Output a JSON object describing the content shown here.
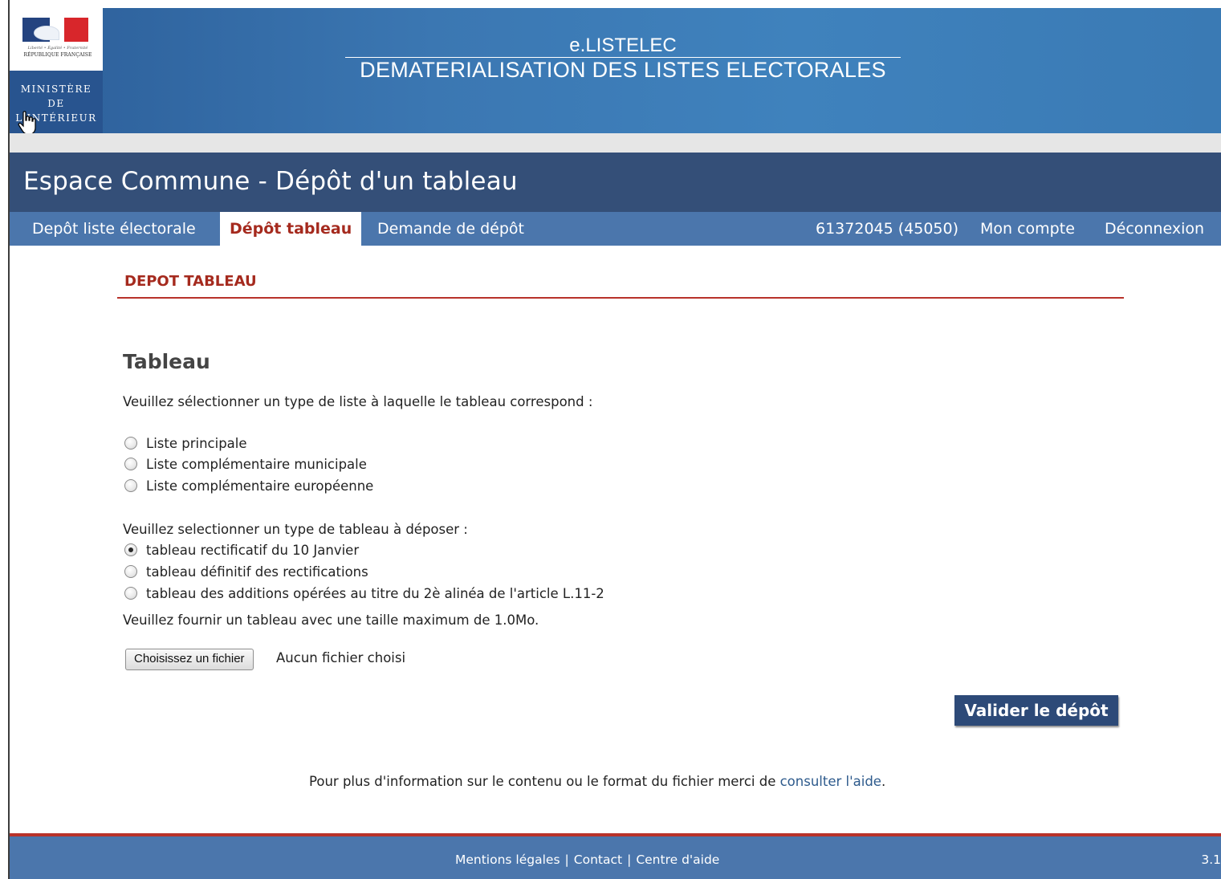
{
  "banner": {
    "logo": {
      "motto": "Liberté • Égalité • Fraternité",
      "republic": "RÉPUBLIQUE FRANÇAISE",
      "ministry_line1": "MINISTÈRE",
      "ministry_line2": "DE",
      "ministry_line3": "L'INTÉRIEUR"
    },
    "app_name": "e.LISTELEC",
    "app_subtitle": "DEMATERIALISATION DES LISTES ELECTORALES"
  },
  "header": {
    "title": "Espace Commune - Dépôt d'un tableau"
  },
  "nav": {
    "items": [
      {
        "label": "Depôt liste électorale",
        "active": false
      },
      {
        "label": "Dépôt tableau",
        "active": true
      },
      {
        "label": "Demande de dépôt",
        "active": false
      }
    ],
    "account_id": "61372045 (45050)",
    "my_account": "Mon compte",
    "logout": "Déconnexion"
  },
  "main": {
    "section_title": "DEPOT TABLEAU",
    "heading": "Tableau",
    "list_prompt": "Veuillez sélectionner un type de liste à laquelle le tableau correspond :",
    "list_options": [
      {
        "label": "Liste principale",
        "checked": false
      },
      {
        "label": "Liste complémentaire municipale",
        "checked": false
      },
      {
        "label": "Liste complémentaire européenne",
        "checked": false
      }
    ],
    "table_prompt": "Veuillez selectionner un type de tableau à déposer :",
    "table_options": [
      {
        "label": "tableau rectificatif du 10 Janvier",
        "checked": true
      },
      {
        "label": "tableau définitif des rectifications",
        "checked": false
      },
      {
        "label": "tableau des additions opérées au titre du 2è alinéa de l'article L.11-2",
        "checked": false
      }
    ],
    "size_note": "Veuillez fournir un tableau avec une taille maximum de 1.0Mo.",
    "file_button": "Choisissez un fichier",
    "file_status": "Aucun fichier choisi",
    "submit": "Valider le dépôt",
    "info_prefix": "Pour plus d'information sur le contenu ou le format du fichier merci de ",
    "info_link": "consulter l'aide",
    "info_suffix": "."
  },
  "footer": {
    "legal": "Mentions légales",
    "contact": "Contact",
    "help_center": "Centre d'aide",
    "separator": "|",
    "version": "3.1"
  }
}
